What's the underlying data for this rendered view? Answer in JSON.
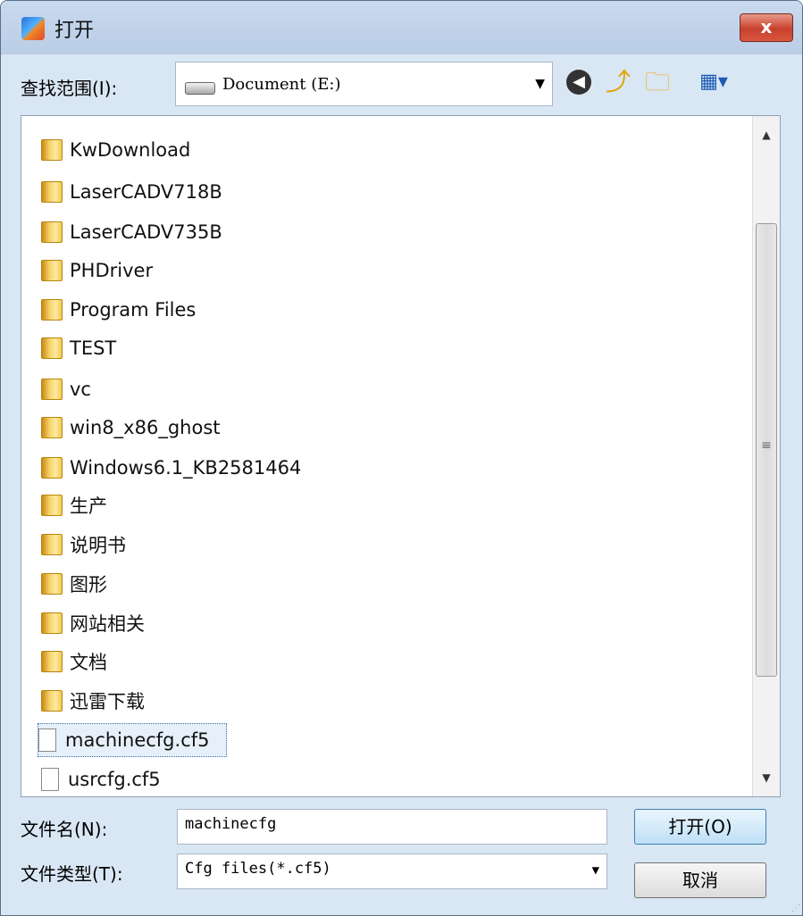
{
  "window": {
    "title": "打开",
    "close_label": "x"
  },
  "look_in": {
    "label": "查找范围(I):",
    "value": "Document (E:)"
  },
  "toolbar_icons": [
    "back-icon",
    "up-folder-icon",
    "new-folder-icon",
    "view-menu-icon"
  ],
  "files": [
    {
      "name": "KwDownload",
      "type": "folder"
    },
    {
      "name": "LaserCADV718B",
      "type": "folder"
    },
    {
      "name": "LaserCADV735B",
      "type": "folder"
    },
    {
      "name": "PHDriver",
      "type": "folder"
    },
    {
      "name": "Program Files",
      "type": "folder"
    },
    {
      "name": "TEST",
      "type": "folder"
    },
    {
      "name": "vc",
      "type": "folder"
    },
    {
      "name": "win8_x86_ghost",
      "type": "folder"
    },
    {
      "name": "Windows6.1_KB2581464",
      "type": "folder"
    },
    {
      "name": "生产",
      "type": "folder"
    },
    {
      "name": "说明书",
      "type": "folder"
    },
    {
      "name": "图形",
      "type": "folder"
    },
    {
      "name": "网站相关",
      "type": "folder"
    },
    {
      "name": "文档",
      "type": "folder"
    },
    {
      "name": "迅雷下载",
      "type": "folder"
    },
    {
      "name": "machinecfg.cf5",
      "type": "file",
      "selected": true
    },
    {
      "name": "usrcfg.cf5",
      "type": "file"
    }
  ],
  "file_name": {
    "label": "文件名(N):",
    "value": "machinecfg"
  },
  "file_type": {
    "label": "文件类型(T):",
    "value": "Cfg files(*.cf5)"
  },
  "buttons": {
    "open": "打开(O)",
    "cancel": "取消"
  }
}
